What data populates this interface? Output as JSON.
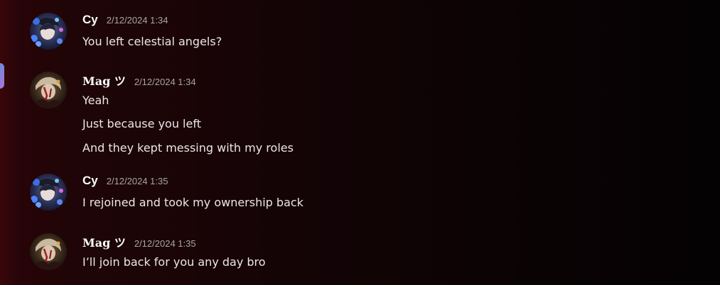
{
  "messages": [
    {
      "author": "Cy",
      "timestamp": "2/12/2024 1:34",
      "avatar": "cy-avatar",
      "lines": [
        "You left celestial angels?"
      ]
    },
    {
      "author": "Mag ツ",
      "timestamp": "2/12/2024 1:34",
      "avatar": "mag-avatar",
      "lines": [
        "Yeah",
        "Just because you left",
        "And they kept messing with my roles"
      ]
    },
    {
      "author": "Cy",
      "timestamp": "2/12/2024 1:35",
      "avatar": "cy-avatar",
      "lines": [
        "I rejoined and took my ownership back"
      ]
    },
    {
      "author": "Mag ツ",
      "timestamp": "2/12/2024 1:35",
      "avatar": "mag-avatar",
      "lines": [
        "I’ll join back for you any day bro"
      ]
    }
  ],
  "colors": {
    "background_left": "#2a0407",
    "background_right": "#040203",
    "username": "#ffffff",
    "timestamp": "#a9a4a6",
    "message_text": "#ece6e8"
  }
}
